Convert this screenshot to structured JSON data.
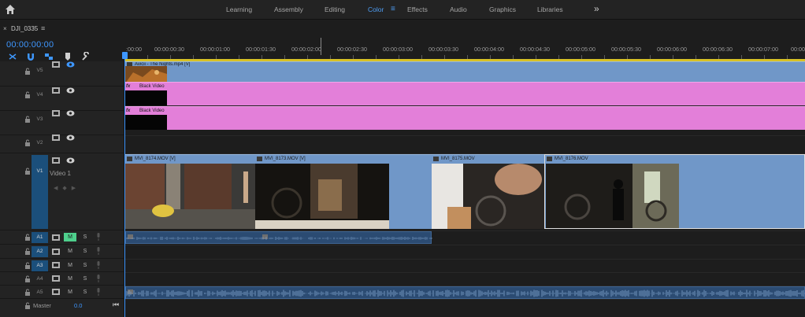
{
  "workspace": {
    "tabs": [
      "Learning",
      "Assembly",
      "Editing",
      "Color",
      "Effects",
      "Audio",
      "Graphics",
      "Libraries"
    ],
    "active_tab": "Color",
    "more": "»"
  },
  "sequence": {
    "close": "×",
    "name": "DJI_0335",
    "menu": "≡",
    "timecode": "00:00:00:00"
  },
  "ruler": {
    "labels": [
      ":00:00",
      "00:00:00:30",
      "00:00:01:00",
      "00:00:01:30",
      "00:00:02:00",
      "00:00:02:30",
      "00:00:03:00",
      "00:00:03:30",
      "00:00:04:00",
      "00:00:04:30",
      "00:00:05:00",
      "00:00:05:30",
      "00:00:06:00",
      "00:00:06:30",
      "00:00:07:00",
      "00:00"
    ]
  },
  "tracks": {
    "video": [
      {
        "id": "V5",
        "name": ""
      },
      {
        "id": "V4",
        "name": ""
      },
      {
        "id": "V3",
        "name": ""
      },
      {
        "id": "V2",
        "name": ""
      },
      {
        "id": "V1",
        "name": "Video 1"
      }
    ],
    "audio": [
      {
        "id": "A1",
        "m": "M",
        "s": "S",
        "muted": true
      },
      {
        "id": "A2",
        "m": "M",
        "s": "S",
        "muted": false
      },
      {
        "id": "A3",
        "m": "M",
        "s": "S",
        "muted": false
      },
      {
        "id": "A4",
        "m": "M",
        "s": "S",
        "muted": false
      },
      {
        "id": "A5",
        "m": "M",
        "s": "S",
        "muted": false
      }
    ],
    "master": {
      "label": "Master",
      "value": "0.0",
      "end_icon": "⏮"
    }
  },
  "clips": {
    "v5": "Avicii - The Nights.mp4 [V]",
    "v4": "Black Video",
    "v3": "Black Video",
    "v1": [
      "MVI_8174.MOV [V]",
      "MVI_8173.MOV [V]",
      "MVI_8175.MOV",
      "MVI_8176.MOV"
    ]
  },
  "colors": {
    "accent": "#3e97ff",
    "work_area": "#d8c226",
    "video_clip": "#7097c8",
    "black_video_clip": "#e37fd9",
    "mute_active": "#4ecf8c"
  }
}
